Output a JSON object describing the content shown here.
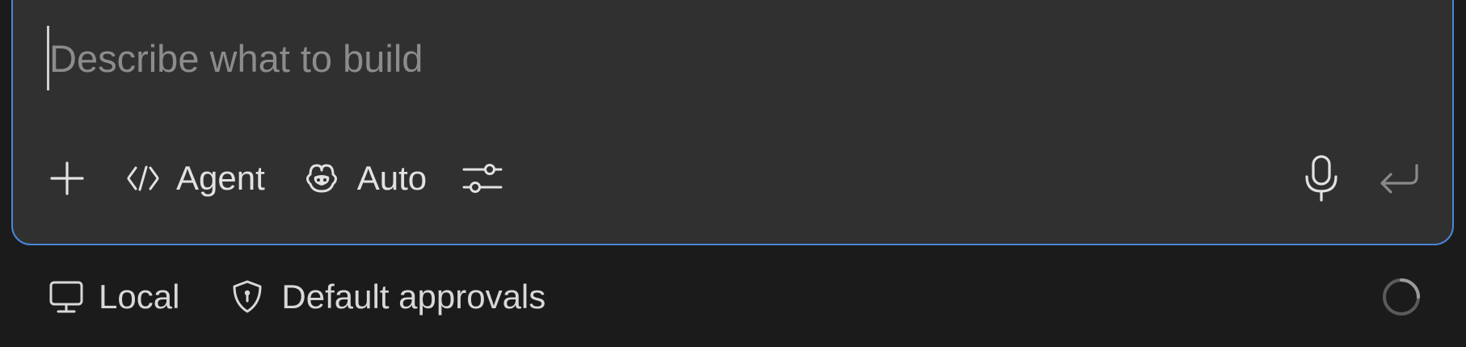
{
  "composer": {
    "placeholder": "Describe what to build",
    "value": ""
  },
  "toolbar": {
    "add_icon": "plus-icon",
    "mode": {
      "icon": "agent-code-icon",
      "label": "Agent"
    },
    "model": {
      "icon": "robot-icon",
      "label": "Auto"
    },
    "settings_icon": "sliders-icon",
    "mic_icon": "microphone-icon",
    "submit_icon": "enter-return-icon"
  },
  "statusbar": {
    "environment": {
      "icon": "monitor-icon",
      "label": "Local"
    },
    "approvals": {
      "icon": "shield-icon",
      "label": "Default approvals"
    },
    "status_icon": "loading-spinner-icon"
  },
  "colors": {
    "background": "#1b1b1b",
    "composer_bg": "#303030",
    "focus_border": "#4a86d8",
    "placeholder": "#8c8c8c",
    "text": "#e2e2e2"
  }
}
